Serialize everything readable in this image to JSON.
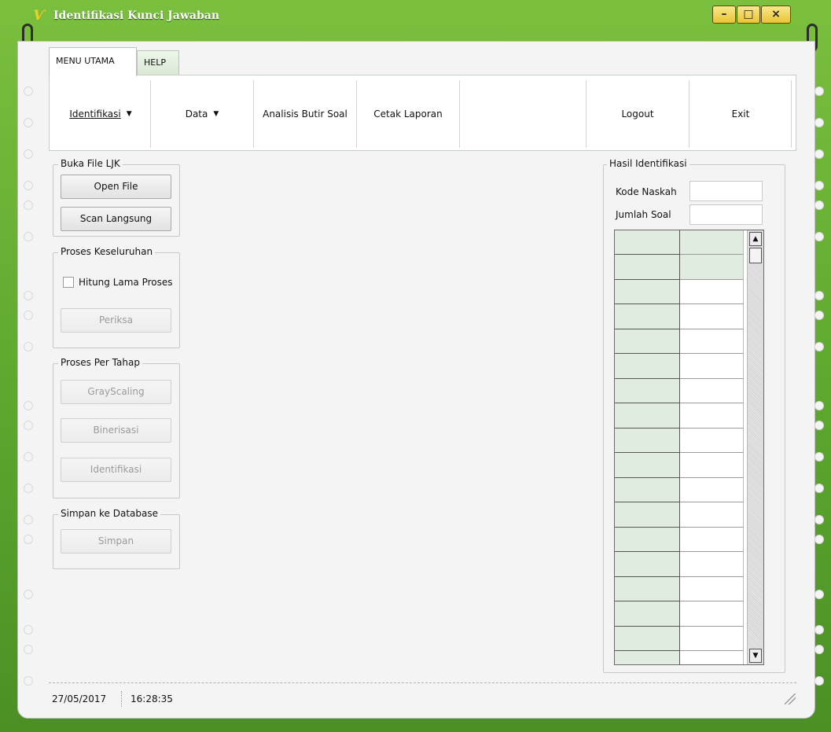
{
  "window": {
    "title": "Identifikasi Kunci Jawaban",
    "icon": "app-logo-icon",
    "controls": {
      "minimize": "–",
      "maximize": "□",
      "close": "×"
    }
  },
  "tabs": [
    {
      "label": "MENU UTAMA",
      "active": true
    },
    {
      "label": "HELP",
      "active": false
    }
  ],
  "ribbon": {
    "identifikasi": "Identifikasi",
    "data": "Data",
    "analisis": "Analisis Butir Soal",
    "cetak": "Cetak Laporan",
    "logout": "Logout",
    "exit": "Exit",
    "dropdown_arrow": "▼"
  },
  "buka_file": {
    "title": "Buka File LJK",
    "open_file": "Open File",
    "scan_langsung": "Scan Langsung"
  },
  "proses_keseluruhan": {
    "title": "Proses Keseluruhan",
    "hitung_label": "Hitung Lama Proses",
    "hitung_checked": false,
    "periksa": "Periksa"
  },
  "proses_per_tahap": {
    "title": "Proses Per Tahap",
    "grayscaling": "GrayScaling",
    "binerisasi": "Binerisasi",
    "identifikasi": "Identifikasi"
  },
  "simpan_db": {
    "title": "Simpan ke Database",
    "simpan": "Simpan"
  },
  "hasil": {
    "title": "Hasil Identifikasi",
    "kode_label": "Kode Naskah",
    "kode_value": "",
    "jumlah_label": "Jumlah Soal",
    "jumlah_value": "",
    "grid_rows": 18
  },
  "status": {
    "date": "27/05/2017",
    "time": "16:28:35"
  }
}
